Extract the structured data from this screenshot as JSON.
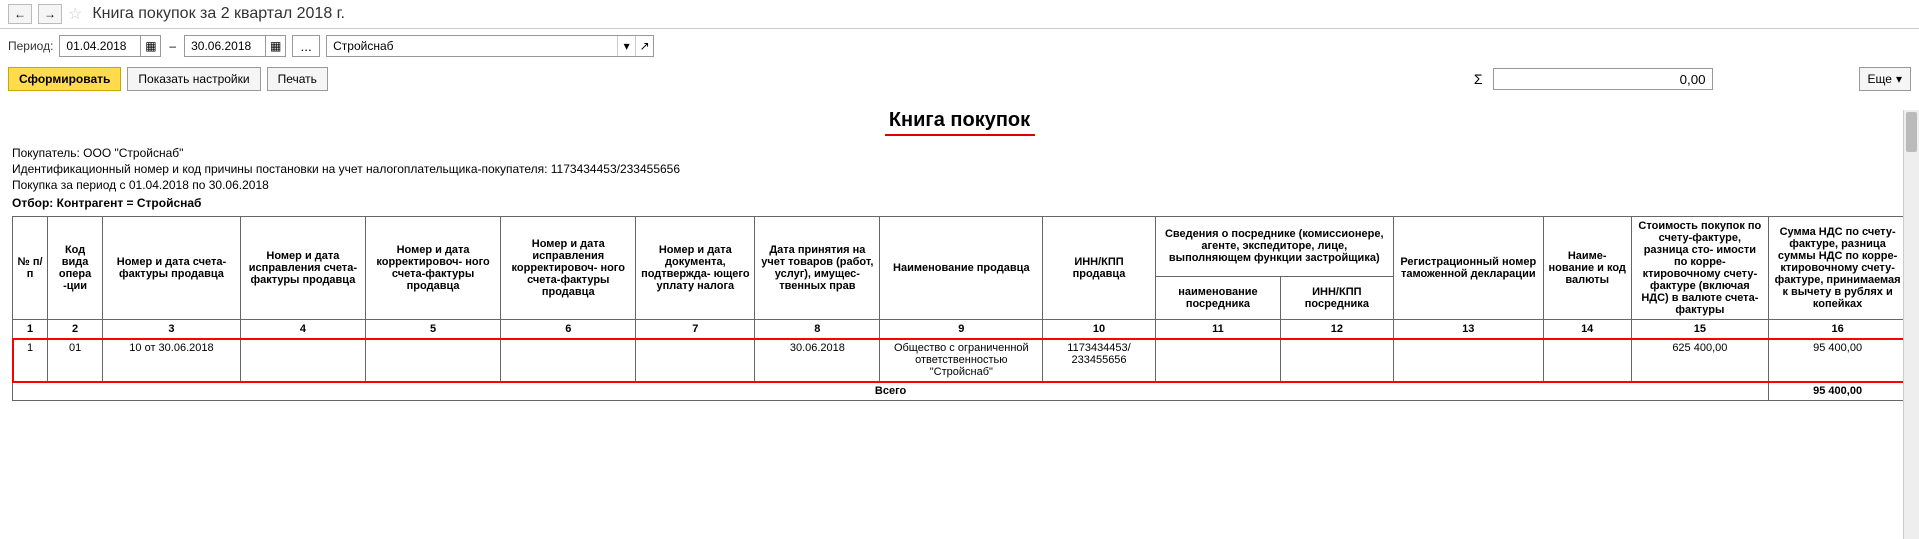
{
  "header": {
    "title": "Книга покупок за 2 квартал 2018 г."
  },
  "toolbar": {
    "period_label": "Период:",
    "date_from": "01.04.2018",
    "date_to": "30.06.2018",
    "org": "Стройснаб",
    "dots": "..."
  },
  "actions": {
    "form": "Сформировать",
    "settings": "Показать настройки",
    "print": "Печать",
    "sum": "0,00",
    "more": "Еще"
  },
  "report": {
    "title": "Книга покупок",
    "buyer": "Покупатель:  ООО \"Стройснаб\"",
    "inn": "Идентификационный номер и код причины постановки на учет налогоплательщика-покупателя:  1173434453/233455656",
    "period": "Покупка за период с 01.04.2018 по 30.06.2018",
    "filter": "Отбор: Контрагент = Стройснаб"
  },
  "columns": {
    "c1": "№ п/п",
    "c2": "Код вида опера -ции",
    "c3": "Номер и дата счета-фактуры продавца",
    "c4": "Номер и дата исправления счета-фактуры продавца",
    "c5": "Номер и дата корректировоч- ного счета-фактуры продавца",
    "c6": "Номер и дата исправления корректировоч- ного счета-фактуры продавца",
    "c7": "Номер и дата документа, подтвержда- ющего уплату налога",
    "c8": "Дата принятия на учет товаров (работ, услуг), имущес- твенных прав",
    "c9": "Наименование продавца",
    "c10": "ИНН/КПП продавца",
    "c11_12": "Сведения о посреднике (комиссионере, агенте, экспедиторе, лице, выполняющем функции застройщика)",
    "c11": "наименование посредника",
    "c12": "ИНН/КПП посредника",
    "c13": "Регистрационный номер таможенной декларации",
    "c14": "Наиме- нование и код валюты",
    "c15": "Стоимость покупок по счету-фактуре, разница сто- имости по корре- ктировочному счету-фактуре (включая НДС) в валюте счета-фактуры",
    "c16": "Сумма НДС по счету-фактуре, разница суммы НДС по корре- ктировочному счету-фактуре, принимаемая к вычету в рублях и копейках"
  },
  "colnums": {
    "n1": "1",
    "n2": "2",
    "n3": "3",
    "n4": "4",
    "n5": "5",
    "n6": "6",
    "n7": "7",
    "n8": "8",
    "n9": "9",
    "n10": "10",
    "n11": "11",
    "n12": "12",
    "n13": "13",
    "n14": "14",
    "n15": "15",
    "n16": "16"
  },
  "row1": {
    "c1": "1",
    "c2": "01",
    "c3": "10 от 30.06.2018",
    "c8": "30.06.2018",
    "c9": "Общество с ограниченной ответственностью \"Стройснаб\"",
    "c10": "1173434453/ 233455656",
    "c15": "625 400,00",
    "c16": "95 400,00"
  },
  "total": {
    "label": "Всего",
    "c16": "95 400,00"
  }
}
